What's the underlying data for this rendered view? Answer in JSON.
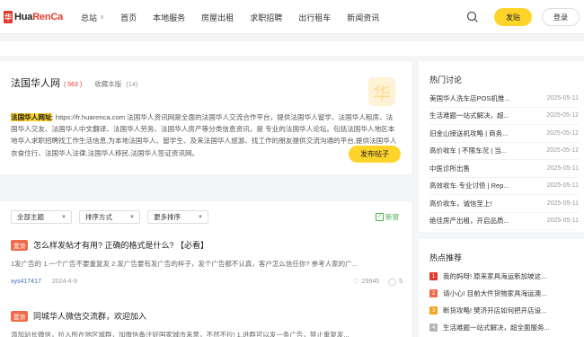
{
  "header": {
    "logo_letter": "华",
    "logo_prefix": "Hua",
    "logo_brand": "RenCa",
    "nav": [
      "总站",
      "首页",
      "本地服务",
      "房屋出租",
      "求职招聘",
      "出行租车",
      "新闻资讯"
    ],
    "post_label": "发贴",
    "login_label": "登录"
  },
  "site": {
    "title": "法国华人网",
    "count": "( 563 )",
    "fav_label": "收藏本版",
    "fav_count": "(14)",
    "highlight": "法国华人网址",
    "description": ": https://fr.huarenca.com 法国华人资讯网是全面的法国华人交流合作平台，提供法国华人留学、法国华人租房、法国华人交友、法国华人中文翻译、法国华人劳务、法国华人房产等分类信息资讯，是 专业的法国华人论坛。包括法国华人地区本地华人求职招聘找工作生活信息,为本地法国华人、留学生、及来法国华人旅游、找工作的朋友提供交流沟通的平台,提供法国华人衣食住行、法国华人法律,法国华人移民,法国华人签证资讯网。",
    "publish_label": "发布帖子"
  },
  "filters": {
    "topics": "全部主题",
    "sort": "排序方式",
    "more": "更多排序",
    "refresh": "新窗"
  },
  "posts": [
    {
      "tag": "置顶",
      "title": "怎么样发帖才有用? 正确的格式是什么? 【必看】",
      "excerpt": "1发广告的 1.一个广告不要重复发 2.发广告要有发广告的样子，发个广告都不认真，客户怎么信任你? 参考人家的广...",
      "author": "xys417417",
      "date": "2024-4-9",
      "views": "29940",
      "comments": "5"
    },
    {
      "tag": "置顶",
      "title": "同城华人微信交流群，欢迎加入",
      "excerpt": "添加站长微信，拉入所在地区城群，加微信备注好国家城市来意，不然不拉! 1.进群可以发一条广告，禁止重复发..."
    }
  ],
  "hot": {
    "title": "热门讨论",
    "items": [
      {
        "t": "美国华人洗车店POS机推...",
        "d": "2025-05-11"
      },
      {
        "t": "生活难题一站式解决，超...",
        "d": "2025-05-12"
      },
      {
        "t": "旧金山接送机攻略 | 商务...",
        "d": "2025-05-12"
      },
      {
        "t": "高价收车 | 不限车况 | 当...",
        "d": "2025-05-12"
      },
      {
        "t": "中医诊所出售",
        "d": "2025-05-11"
      },
      {
        "t": "高效收车·专业讨债 | Rep...",
        "d": "2025-05-11"
      },
      {
        "t": "高价收车，诚信至上!",
        "d": "2025-05-11"
      },
      {
        "t": "绝佳房产出租，开启品质...",
        "d": "2025-05-11"
      }
    ]
  },
  "recommend": {
    "title": "热点推荐",
    "items": [
      {
        "rank": "1",
        "t": "我的妈呀! 原来家具海运新加坡这...",
        "color": "#e23b2e"
      },
      {
        "rank": "2",
        "t": "请小心! 目前大件货物家具海运澳...",
        "color": "#f06b4a"
      },
      {
        "rank": "3",
        "t": "断货攻略! 樊济开店如何把开店设...",
        "color": "#f5a623"
      },
      {
        "rank": "4",
        "t": "生活难题一站式解决，超全面服务...",
        "color": "#b5b5b5"
      }
    ]
  }
}
